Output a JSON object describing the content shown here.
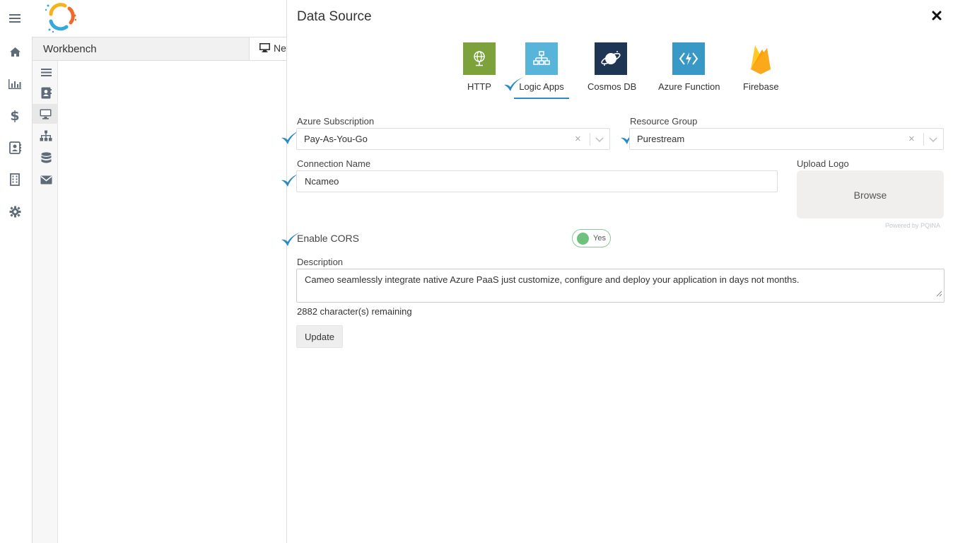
{
  "workbench": {
    "title": "Workbench",
    "tab_label": "Ne"
  },
  "panel": {
    "title": "Data Source",
    "sources": [
      {
        "label": "HTTP"
      },
      {
        "label": "Logic Apps"
      },
      {
        "label": "Cosmos DB"
      },
      {
        "label": "Azure Function"
      },
      {
        "label": "Firebase"
      }
    ],
    "selected_source": "Logic Apps",
    "azure_subscription": {
      "label": "Azure Subscription",
      "value": "Pay-As-You-Go"
    },
    "resource_group": {
      "label": "Resource Group",
      "value": "Purestream"
    },
    "connection_name": {
      "label": "Connection Name",
      "value": "Ncameo"
    },
    "upload_logo": {
      "label": "Upload Logo",
      "button": "Browse",
      "powered_by": "Powered by PQINA"
    },
    "enable_cors": {
      "label": "Enable CORS",
      "toggle_text": "Yes",
      "enabled": true
    },
    "description": {
      "label": "Description",
      "value": "Cameo seamlessly integrate native Azure PaaS just customize, configure and deploy your application in days not months.",
      "remaining": "2882 character(s) remaining"
    },
    "update_button": "Update"
  },
  "colors": {
    "http_tile": "#7da23b",
    "logic_tile": "#59b4d9",
    "cosmos_tile": "#1e3653",
    "function_tile": "#3999c6",
    "check": "#2a8ac6",
    "toggle_on": "#6fc27d"
  }
}
